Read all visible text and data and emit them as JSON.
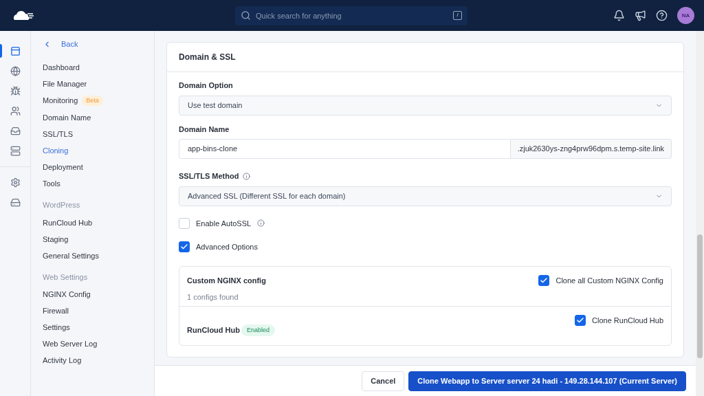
{
  "topbar": {
    "search": {
      "placeholder": "Quick search for anything",
      "shortcut": "/"
    },
    "avatar": "NA"
  },
  "rail": [
    [
      {
        "kind": "sites",
        "selected": true
      },
      {
        "kind": "globe",
        "selected": false
      },
      {
        "kind": "bug",
        "selected": false
      },
      {
        "kind": "team",
        "selected": false
      },
      {
        "kind": "inbox",
        "selected": false
      },
      {
        "kind": "dns",
        "selected": false
      }
    ],
    [
      {
        "kind": "settings",
        "selected": false
      },
      {
        "kind": "storage",
        "selected": false
      }
    ]
  ],
  "sidebar": {
    "back": "Back",
    "sections": [
      {
        "items": [
          {
            "label": "Dashboard",
            "selected": false
          },
          {
            "label": "File Manager",
            "selected": false
          },
          {
            "label": "Monitoring",
            "badge": "Beta",
            "selected": false
          },
          {
            "label": "Domain Name",
            "selected": false
          },
          {
            "label": "SSL/TLS",
            "selected": false
          },
          {
            "label": "Cloning",
            "selected": true
          },
          {
            "label": "Deployment",
            "selected": false
          },
          {
            "label": "Tools",
            "selected": false
          }
        ]
      },
      {
        "heading": "WordPress",
        "items": [
          {
            "label": "RunCloud Hub",
            "selected": false
          },
          {
            "label": "Staging",
            "selected": false
          },
          {
            "label": "General Settings",
            "selected": false
          }
        ]
      },
      {
        "heading": "Web Settings",
        "items": [
          {
            "label": "NGINX Config",
            "selected": false
          },
          {
            "label": "Firewall",
            "selected": false
          },
          {
            "label": "Settings",
            "selected": false
          },
          {
            "label": "Web Server Log",
            "selected": false
          },
          {
            "label": "Activity Log",
            "selected": false
          }
        ]
      }
    ]
  },
  "card": {
    "title": "Domain & SSL",
    "domain_option": {
      "label": "Domain Option",
      "value": "Use test domain"
    },
    "domain_name": {
      "label": "Domain Name",
      "value": "app-bins-clone",
      "suffix": ".zjuk2630ys-zng4prw96dpm.s.temp-site.link"
    },
    "ssl_method": {
      "label": "SSL/TLS Method",
      "value": "Advanced SSL (Different SSL for each domain)"
    },
    "checkboxes": [
      {
        "label": "Enable AutoSSL",
        "info": true,
        "checked": false
      },
      {
        "label": "Advanced Options",
        "info": false,
        "checked": true
      }
    ],
    "advanced": [
      {
        "title": "Custom NGINX config",
        "subtitle": "1 configs found",
        "option": "Clone all Custom NGINX Config",
        "checked": true
      },
      {
        "title": "RunCloud Hub",
        "badge": "Enabled",
        "option": "Clone RunCloud Hub",
        "checked": true
      }
    ]
  },
  "footer": {
    "buttons": [
      {
        "label": "Cancel",
        "kind": "secondary"
      },
      {
        "label": "Clone Webapp to Server server 24 hadi - 149.28.144.107 (Current Server)",
        "kind": "primary"
      }
    ]
  }
}
